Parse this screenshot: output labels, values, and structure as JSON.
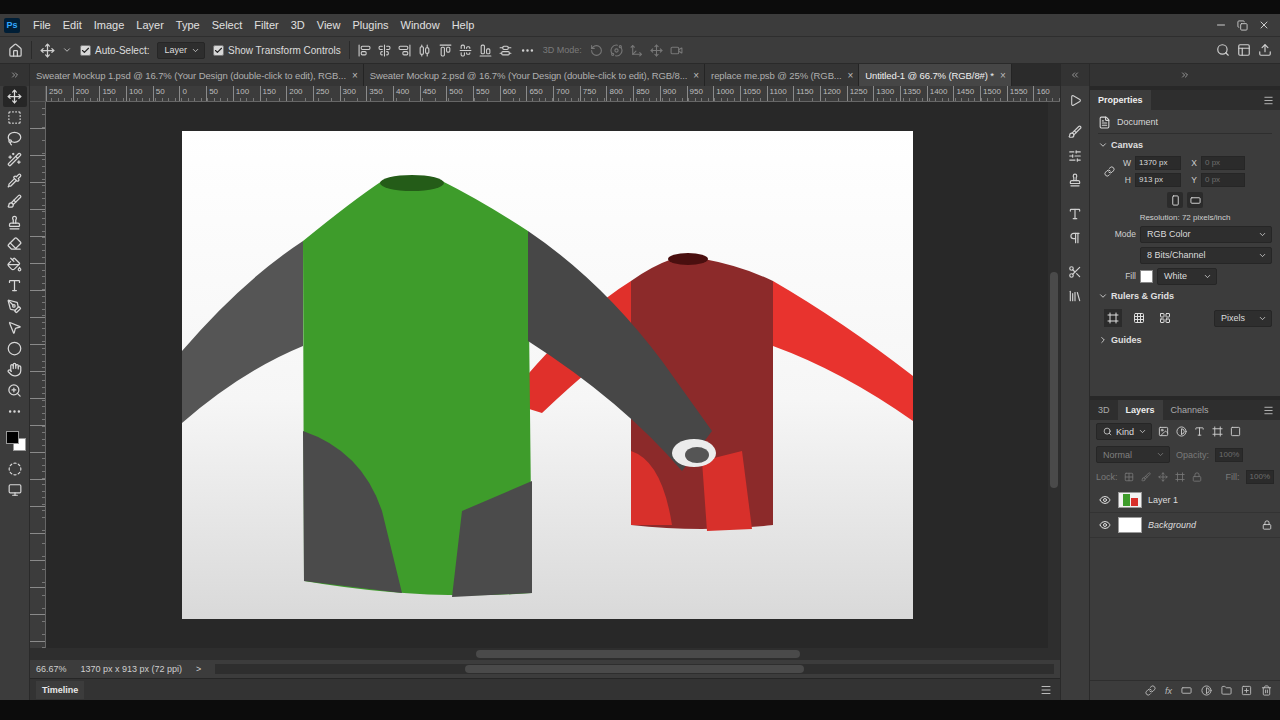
{
  "window": {
    "app": "Ps"
  },
  "menu": [
    "File",
    "Edit",
    "Image",
    "Layer",
    "Type",
    "Select",
    "Filter",
    "3D",
    "View",
    "Plugins",
    "Window",
    "Help"
  ],
  "options": {
    "auto_select": {
      "label": "Auto-Select:",
      "checked": true
    },
    "auto_select_target": "Layer",
    "transform_controls": {
      "label": "Show Transform Controls",
      "checked": true
    },
    "mode_3d": "3D Mode:"
  },
  "document_tabs": [
    {
      "label": "Sweater Mockup 1.psd @ 16.7% (Your Design (double-click to edit), RGB...",
      "selected": false,
      "close": "×"
    },
    {
      "label": "Sweater Mockup 2.psd @ 16.7% (Your Design (double-click to edit), RGB/8...",
      "selected": false,
      "close": "×"
    },
    {
      "label": "replace me.psb @ 25% (RGB...",
      "selected": false,
      "close": "×"
    },
    {
      "label": "Untitled-1 @ 66.7% (RGB/8#) *",
      "selected": true,
      "close": "×"
    }
  ],
  "ruler_ticks": [
    "250",
    "200",
    "150",
    "100",
    "50",
    "0",
    "50",
    "100",
    "150",
    "200",
    "250",
    "300",
    "350",
    "400",
    "450",
    "500",
    "550",
    "600",
    "650",
    "700",
    "750",
    "800",
    "850",
    "900",
    "950",
    "1000",
    "1050",
    "1100",
    "1150",
    "1200",
    "1250",
    "1300",
    "1350",
    "1400",
    "1450",
    "1500",
    "1550",
    "160"
  ],
  "tools": [
    {
      "selected": true
    },
    {
      "selected": false
    },
    {
      "selected": false
    },
    {
      "selected": false
    },
    {
      "selected": false
    },
    {
      "selected": false
    },
    {
      "selected": false
    },
    {
      "selected": false
    },
    {
      "selected": false
    },
    {
      "selected": false
    },
    {
      "selected": false
    },
    {
      "selected": false
    },
    {
      "selected": false
    },
    {
      "selected": false
    },
    {
      "selected": false
    },
    {
      "selected": false
    }
  ],
  "swatches": {
    "foreground": "#000000",
    "background": "#ffffff"
  },
  "properties": {
    "title": "Document",
    "tab": "Properties",
    "canvas": {
      "header": "Canvas",
      "w_label": "W",
      "w": "1370 px",
      "x_label": "X",
      "x": "0 px",
      "h_label": "H",
      "h": "913 px",
      "y_label": "Y",
      "y": "0 px",
      "resolution": "Resolution: 72 pixels/inch",
      "mode_label": "Mode",
      "mode": "RGB Color",
      "bits": "8 Bits/Channel",
      "fill_label": "Fill",
      "fill": "White",
      "fill_color": "#ffffff"
    },
    "rulers": {
      "header": "Rulers & Grids",
      "units": "Pixels"
    },
    "guides": {
      "header": "Guides"
    }
  },
  "layers_panel": {
    "tabs": [
      {
        "label": "3D",
        "selected": false
      },
      {
        "label": "Layers",
        "selected": true
      },
      {
        "label": "Channels",
        "selected": false
      }
    ],
    "filter": "Kind",
    "blend": "Normal",
    "opacity_label": "Opacity:",
    "opacity": "100%",
    "lock_label": "Lock:",
    "fill_label": "Fill:",
    "fill": "100%",
    "layers": [
      {
        "name": "Layer 1",
        "visible": true,
        "locked": false,
        "selected": false,
        "kind": "image"
      },
      {
        "name": "Background",
        "visible": true,
        "locked": true,
        "selected": false,
        "kind": "background"
      }
    ],
    "fx": "fx"
  },
  "status_bar": {
    "zoom": "66.67%",
    "info": "1370 px x 913 px (72 ppi)",
    "arrow": ">"
  },
  "timeline": {
    "label": "Timeline"
  }
}
